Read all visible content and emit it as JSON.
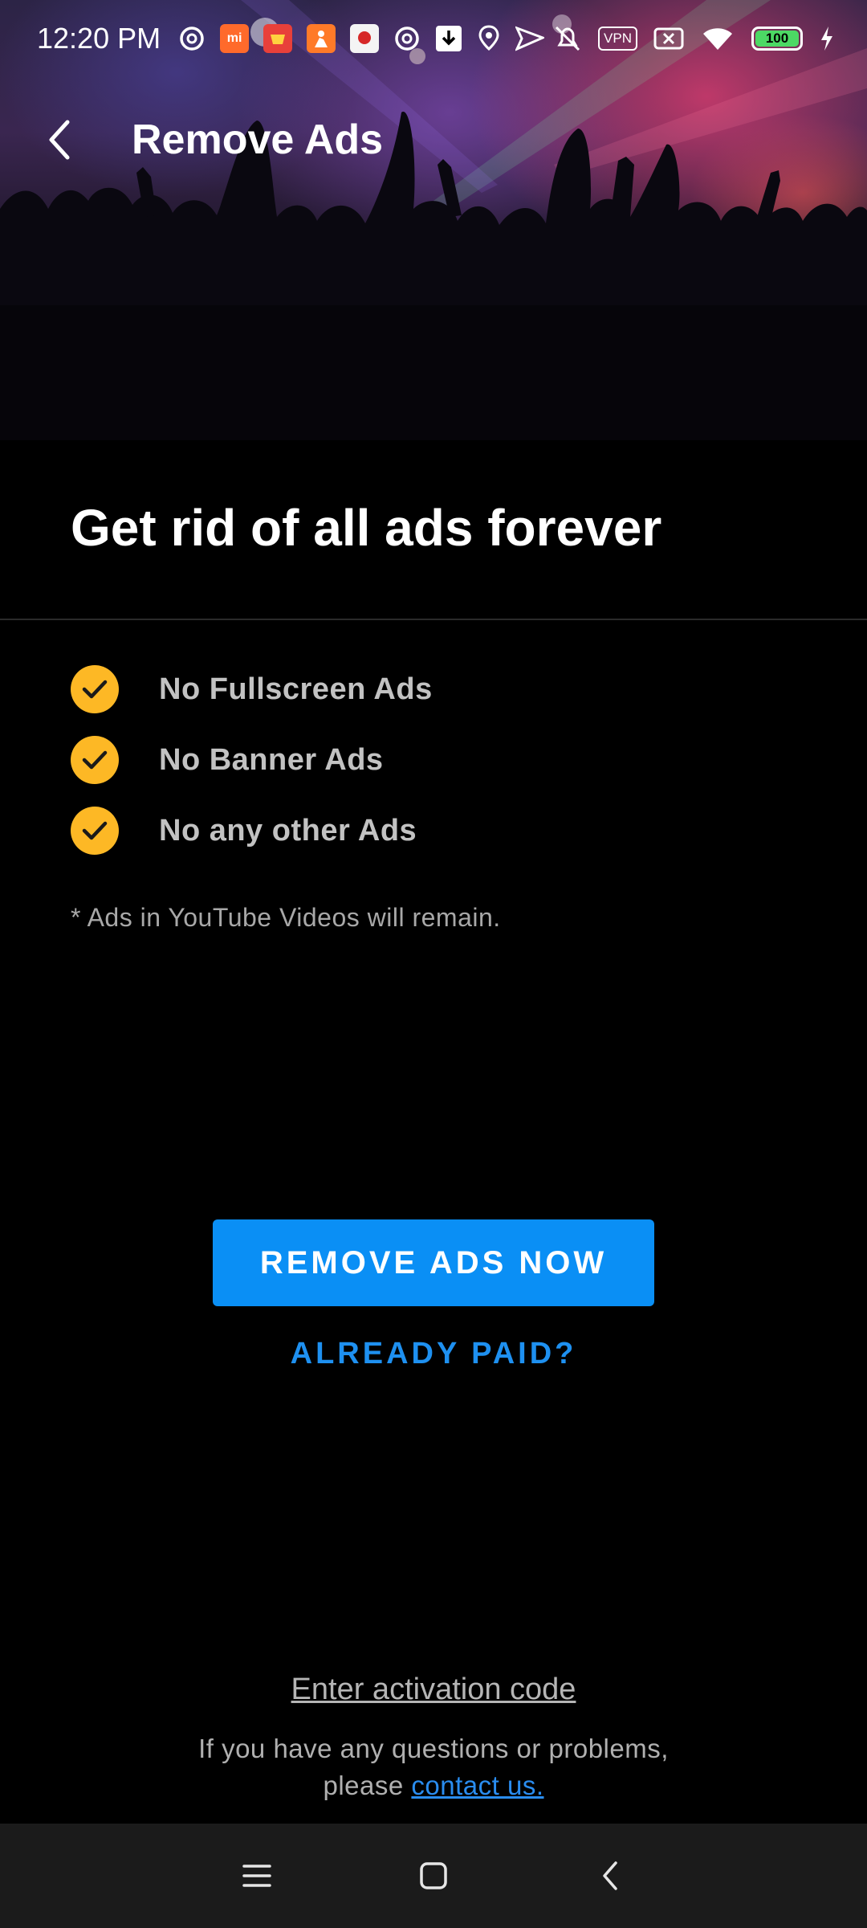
{
  "status_bar": {
    "time": "12:20 PM",
    "app_badge_mi": "mi",
    "vpn_label": "VPN",
    "battery_level": "100"
  },
  "header": {
    "title": "Remove Ads"
  },
  "main": {
    "headline": "Get rid of all ads forever",
    "features": [
      {
        "label": "No Fullscreen Ads"
      },
      {
        "label": "No Banner Ads"
      },
      {
        "label": "No any other Ads"
      }
    ],
    "note": "* Ads in YouTube Videos will remain.",
    "primary_button": "REMOVE ADS NOW",
    "secondary_link": "ALREADY PAID?",
    "activation_link": "Enter activation code",
    "help_text_1": "If you have any questions or problems,",
    "help_text_2": "please",
    "contact_link": "contact us."
  },
  "colors": {
    "accent_blue": "#0a8ff5",
    "check_yellow": "#fdb825",
    "background": "#000000"
  },
  "icons": {
    "back": "back-arrow-icon",
    "check": "check-icon",
    "nav_menu": "menu-icon",
    "nav_home": "home-icon",
    "nav_back": "back-icon"
  }
}
